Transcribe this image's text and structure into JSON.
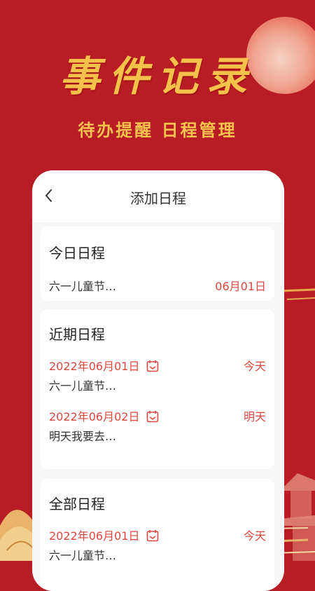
{
  "banner": {
    "headline": "事件记录",
    "subline": "待办提醒 日程管理"
  },
  "nav": {
    "title": "添加日程"
  },
  "today_section": {
    "title": "今日日程",
    "item": "六一儿童节…",
    "date": "06月01日"
  },
  "recent_section": {
    "title": "近期日程",
    "entries": [
      {
        "date": "2022年06月01日",
        "item": "六一儿童节…",
        "tag": "今天"
      },
      {
        "date": "2022年06月02日",
        "item": "明天我要去…",
        "tag": "明天"
      }
    ]
  },
  "all_section": {
    "title": "全部日程",
    "entries": [
      {
        "date": "2022年06月01日",
        "item": "六一儿童节…",
        "tag": "今天"
      }
    ]
  },
  "colors": {
    "background": "#B81C24",
    "gold": "#F4C24A",
    "accent_red": "#E0453E"
  },
  "icons": [
    "back-arrow-icon",
    "calendar-icon"
  ]
}
